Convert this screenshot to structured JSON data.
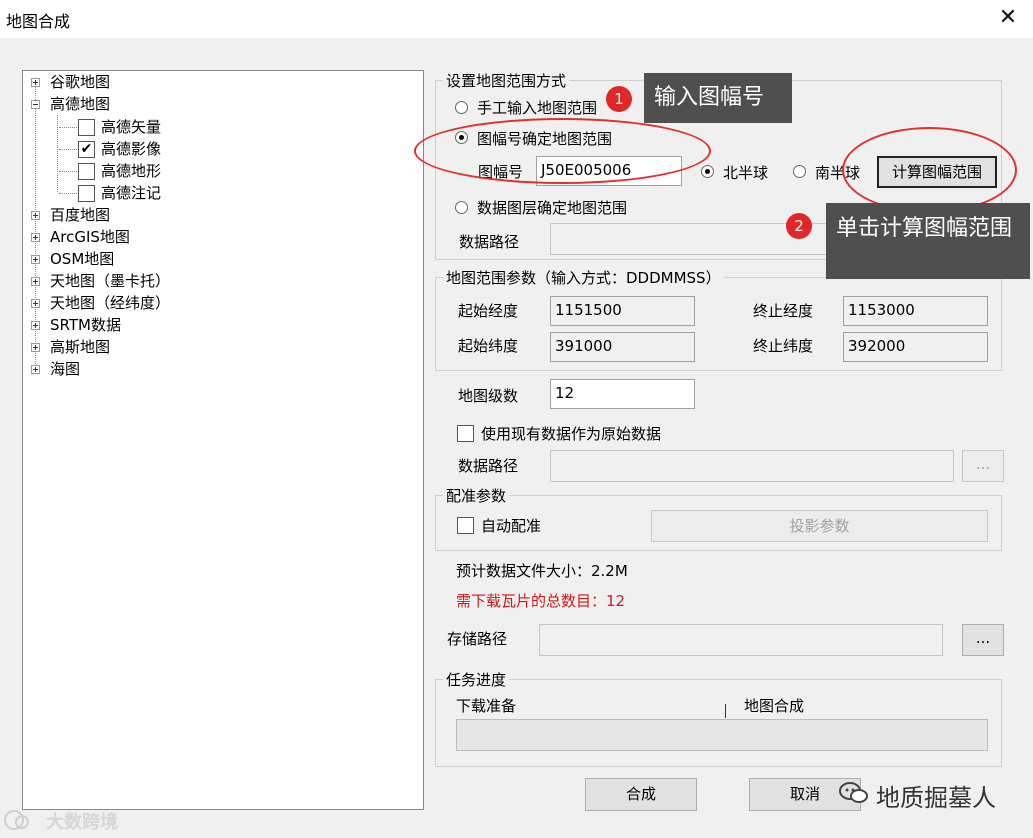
{
  "window": {
    "title": "地图合成",
    "close_glyph": "✕"
  },
  "tree": {
    "items": [
      {
        "label": "谷歌地图",
        "expander": "plus"
      },
      {
        "label": "高德地图",
        "expander": "minus"
      },
      {
        "label": "高德矢量",
        "checked": false
      },
      {
        "label": "高德影像",
        "checked": true
      },
      {
        "label": "高德地形",
        "checked": false
      },
      {
        "label": "高德注记",
        "checked": false
      },
      {
        "label": "百度地图",
        "expander": "plus"
      },
      {
        "label": "ArcGIS地图",
        "expander": "plus"
      },
      {
        "label": "OSM地图",
        "expander": "plus"
      },
      {
        "label": "天地图（墨卡托）",
        "expander": "plus"
      },
      {
        "label": "天地图（经纬度）",
        "expander": "plus"
      },
      {
        "label": "SRTM数据",
        "expander": "plus"
      },
      {
        "label": "高斯地图",
        "expander": "plus"
      },
      {
        "label": "海图",
        "expander": "plus"
      }
    ]
  },
  "range_mode": {
    "title": "设置地图范围方式",
    "manual": "手工输入地图范围",
    "sheet": "图幅号确定地图范围",
    "sheet_label": "图幅号",
    "sheet_value": "J50E005006",
    "north": "北半球",
    "south": "南半球",
    "calc_button": "计算图幅范围",
    "layer": "数据图层确定地图范围",
    "path_label": "数据路径",
    "selected": "sheet",
    "hemisphere": "north"
  },
  "params": {
    "title": "地图范围参数（输入方式：DDDMMSS）",
    "start_lon_label": "起始经度",
    "start_lon": "1151500",
    "end_lon_label": "终止经度",
    "end_lon": "1153000",
    "start_lat_label": "起始纬度",
    "start_lat": "391000",
    "end_lat_label": "终止纬度",
    "end_lat": "392000"
  },
  "level": {
    "label": "地图级数",
    "value": "12"
  },
  "use_existing": {
    "label": "使用现有数据作为原始数据",
    "path_label": "数据路径",
    "browse": "..."
  },
  "registration": {
    "title": "配准参数",
    "auto": "自动配准",
    "proj_button": "投影参数"
  },
  "estimate": {
    "size": "预计数据文件大小：2.2M",
    "tiles": "需下载瓦片的总数目：12",
    "tiles_color": "#d01818"
  },
  "storage": {
    "label": "存储路径",
    "browse": "..."
  },
  "progress": {
    "title": "任务进度",
    "download": "下载准备",
    "compose": "地图合成",
    "fraction": 0
  },
  "buttons": {
    "ok": "合成",
    "cancel": "取消"
  },
  "annotations": {
    "step1_num": "1",
    "step1_text": "输入图幅号",
    "step2_num": "2",
    "step2_text": "单击计算图幅范围"
  },
  "watermarks": {
    "left": "大数跨境",
    "right": "地质掘墓人"
  }
}
